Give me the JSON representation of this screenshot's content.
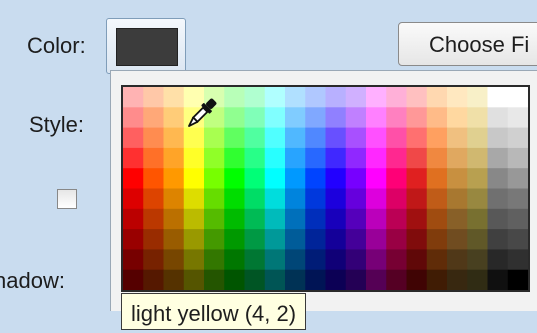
{
  "labels": {
    "color": "Color:",
    "style": "Style:",
    "shadow": "nadow:"
  },
  "current_color": {
    "hex": "#3c3c3c"
  },
  "choose_button": {
    "label": "Choose Fi"
  },
  "style_checkbox": {
    "checked": false
  },
  "color_picker": {
    "columns": 20,
    "rows": 10,
    "colors": [
      [
        "#ffb3b3",
        "#ffc8a8",
        "#ffe0a8",
        "#ffffb0",
        "#d8ffb0",
        "#b8ffb8",
        "#b0ffd0",
        "#b0ffff",
        "#b0e0ff",
        "#b0c8ff",
        "#b8b0ff",
        "#d0b0ff",
        "#ffb0ff",
        "#ffb0d8",
        "#ffc0c0",
        "#ffd8b0",
        "#ffe8c0",
        "#f8f0c8",
        "#ffffff",
        "#ffffff"
      ],
      [
        "#ff8c8c",
        "#ffa878",
        "#ffcc78",
        "#ffff80",
        "#c0ff80",
        "#90ff90",
        "#80ffb8",
        "#80ffff",
        "#80ccff",
        "#80a8ff",
        "#9080ff",
        "#c080ff",
        "#ff80ff",
        "#ff80c0",
        "#ff9898",
        "#ffbb88",
        "#ffd8a0",
        "#f0e0a8",
        "#e0e0e0",
        "#e8e8e8"
      ],
      [
        "#ff6060",
        "#ff8c50",
        "#ffb850",
        "#ffff50",
        "#a8ff50",
        "#60ff60",
        "#50ffa0",
        "#50ffff",
        "#50b8ff",
        "#5088ff",
        "#6850ff",
        "#a850ff",
        "#ff50ff",
        "#ff50a8",
        "#ff7070",
        "#ffa060",
        "#f0c080",
        "#e0d090",
        "#c8c8c8",
        "#d0d0d0"
      ],
      [
        "#ff3030",
        "#ff7028",
        "#ffa428",
        "#ffff28",
        "#90ff28",
        "#30ff30",
        "#28ff88",
        "#28ffff",
        "#28a4ff",
        "#2868ff",
        "#4028ff",
        "#9028ff",
        "#ff28ff",
        "#ff2890",
        "#f04848",
        "#f08840",
        "#e0a860",
        "#d0b870",
        "#a8a8a8",
        "#b8b8b8"
      ],
      [
        "#ff0000",
        "#ff5500",
        "#ff9900",
        "#ffff00",
        "#77ff00",
        "#00ff00",
        "#00ff77",
        "#00ffff",
        "#0099ff",
        "#0044ff",
        "#2200ff",
        "#7700ff",
        "#ff00ff",
        "#ff0077",
        "#e02020",
        "#e07020",
        "#c89040",
        "#b8a050",
        "#888888",
        "#989898"
      ],
      [
        "#dd0000",
        "#dd4400",
        "#dd8400",
        "#dddd00",
        "#66dd00",
        "#00dd00",
        "#00dd66",
        "#00dddd",
        "#0084dd",
        "#0038dd",
        "#1c00dd",
        "#6600dd",
        "#dd00dd",
        "#dd0066",
        "#c01818",
        "#c05c18",
        "#a87830",
        "#988840",
        "#707070",
        "#787878"
      ],
      [
        "#bb0000",
        "#bb3800",
        "#bb7000",
        "#bbbb00",
        "#55bb00",
        "#00bb00",
        "#00bb55",
        "#00bbbb",
        "#0070bb",
        "#002ebb",
        "#1800bb",
        "#5500bb",
        "#bb00bb",
        "#bb0055",
        "#a01010",
        "#a04c10",
        "#886028",
        "#787030",
        "#585858",
        "#606060"
      ],
      [
        "#990000",
        "#992c00",
        "#995c00",
        "#999900",
        "#449900",
        "#009900",
        "#009944",
        "#009999",
        "#005c99",
        "#002499",
        "#140099",
        "#440099",
        "#990099",
        "#990044",
        "#800c0c",
        "#803c0c",
        "#704c20",
        "#605828",
        "#404040",
        "#484848"
      ],
      [
        "#770000",
        "#772200",
        "#774600",
        "#777700",
        "#337700",
        "#007700",
        "#007733",
        "#007777",
        "#004677",
        "#001c77",
        "#100077",
        "#330077",
        "#770077",
        "#770033",
        "#600808",
        "#602c08",
        "#503818",
        "#484020",
        "#282828",
        "#303030"
      ],
      [
        "#550000",
        "#551800",
        "#553200",
        "#555500",
        "#245500",
        "#005500",
        "#005524",
        "#005555",
        "#003255",
        "#001455",
        "#0c0055",
        "#240055",
        "#550055",
        "#550024",
        "#400404",
        "#401c04",
        "#382810",
        "#302c14",
        "#101010",
        "#000000"
      ]
    ]
  },
  "tooltip": {
    "text": "light yellow (4, 2)"
  }
}
